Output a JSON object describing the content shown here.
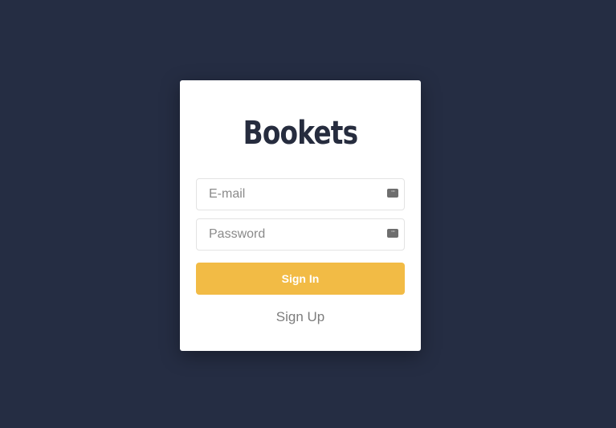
{
  "app": {
    "title": "Bookets"
  },
  "login_form": {
    "email_placeholder": "E-mail",
    "password_placeholder": "Password",
    "signin_label": "Sign In",
    "signup_label": "Sign Up"
  },
  "icons": {
    "autofill": "password-autofill-icon"
  },
  "colors": {
    "background": "#252d43",
    "card": "#ffffff",
    "accent": "#f2bb45",
    "title": "#262c3e"
  }
}
